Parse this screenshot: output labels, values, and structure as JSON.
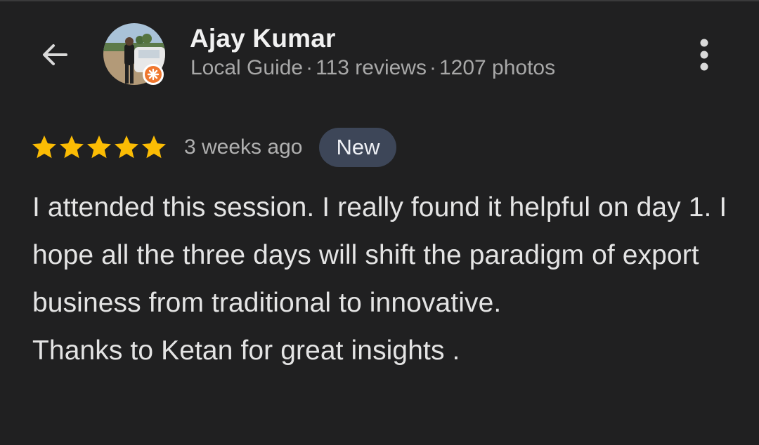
{
  "header": {
    "back_icon": "arrow-left-icon",
    "avatar_icon": "profile-photo",
    "badge_icon": "local-guide-star-badge-icon",
    "reviewer_name": "Ajay Kumar",
    "guide_label": "Local Guide",
    "separator": "·",
    "reviews": "113 reviews",
    "photos": "1207 photos",
    "more_icon": "more-vertical-icon"
  },
  "review": {
    "rating": 5,
    "max_rating": 5,
    "star_color": "#fbbc04",
    "time_ago": "3 weeks ago",
    "badge": "New",
    "text": "I attended this session. I really found it helpful on day 1. I hope all the three days will shift the paradigm of export business from traditional to innovative.",
    "text_line2": "Thanks to Ketan for great insights ."
  },
  "colors": {
    "background": "#202021",
    "badge_bg": "#3d4658",
    "guide_badge": "#f0772e"
  }
}
